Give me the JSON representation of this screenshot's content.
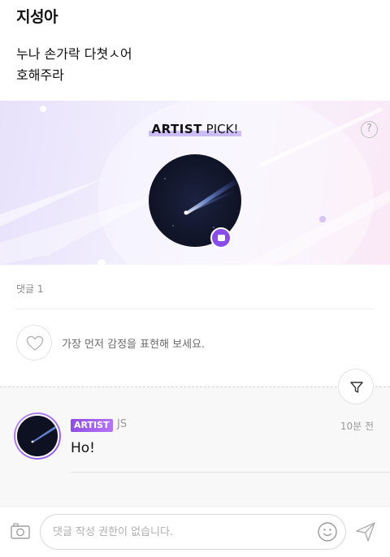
{
  "post": {
    "author": "지성아",
    "body_line1": "누나 손가락 다쳣ㅅ어",
    "body_line2": "호해주라"
  },
  "artist_pick": {
    "title_strong": "ARTIST",
    "title_rest": " PICK!",
    "help_icon": "?"
  },
  "comments": {
    "count_label": "댓글 1",
    "like_prompt": "가장 먼저 감정을 표현해 보세요.",
    "items": [
      {
        "badge": "ARTIST",
        "name": "JS",
        "time": "10분 전",
        "text": "Ho!"
      }
    ]
  },
  "composer": {
    "placeholder": "댓글 작성 권한이 없습니다."
  },
  "colors": {
    "accent": "#8a4ce8",
    "badge_gradient_end": "#b574f3"
  },
  "icons": [
    "question-circle-icon",
    "heart-icon",
    "filter-icon",
    "camera-icon",
    "smiley-icon",
    "send-icon"
  ]
}
